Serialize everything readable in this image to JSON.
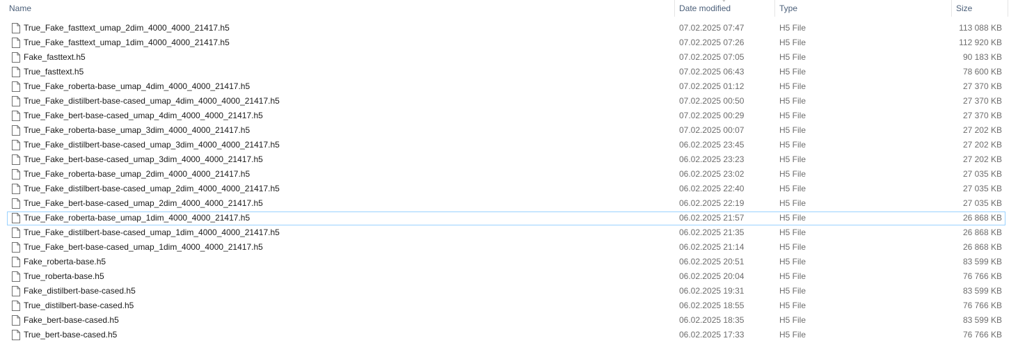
{
  "columns": {
    "name": "Name",
    "date_modified": "Date modified",
    "type": "Type",
    "size": "Size"
  },
  "selected_index": 13,
  "files": [
    {
      "name": "True_Fake_fasttext_umap_2dim_4000_4000_21417.h5",
      "date": "07.02.2025 07:47",
      "type": "H5 File",
      "size": "113 088 KB"
    },
    {
      "name": "True_Fake_fasttext_umap_1dim_4000_4000_21417.h5",
      "date": "07.02.2025 07:26",
      "type": "H5 File",
      "size": "112 920 KB"
    },
    {
      "name": "Fake_fasttext.h5",
      "date": "07.02.2025 07:05",
      "type": "H5 File",
      "size": "90 183 KB"
    },
    {
      "name": "True_fasttext.h5",
      "date": "07.02.2025 06:43",
      "type": "H5 File",
      "size": "78 600 KB"
    },
    {
      "name": "True_Fake_roberta-base_umap_4dim_4000_4000_21417.h5",
      "date": "07.02.2025 01:12",
      "type": "H5 File",
      "size": "27 370 KB"
    },
    {
      "name": "True_Fake_distilbert-base-cased_umap_4dim_4000_4000_21417.h5",
      "date": "07.02.2025 00:50",
      "type": "H5 File",
      "size": "27 370 KB"
    },
    {
      "name": "True_Fake_bert-base-cased_umap_4dim_4000_4000_21417.h5",
      "date": "07.02.2025 00:29",
      "type": "H5 File",
      "size": "27 370 KB"
    },
    {
      "name": "True_Fake_roberta-base_umap_3dim_4000_4000_21417.h5",
      "date": "07.02.2025 00:07",
      "type": "H5 File",
      "size": "27 202 KB"
    },
    {
      "name": "True_Fake_distilbert-base-cased_umap_3dim_4000_4000_21417.h5",
      "date": "06.02.2025 23:45",
      "type": "H5 File",
      "size": "27 202 KB"
    },
    {
      "name": "True_Fake_bert-base-cased_umap_3dim_4000_4000_21417.h5",
      "date": "06.02.2025 23:23",
      "type": "H5 File",
      "size": "27 202 KB"
    },
    {
      "name": "True_Fake_roberta-base_umap_2dim_4000_4000_21417.h5",
      "date": "06.02.2025 23:02",
      "type": "H5 File",
      "size": "27 035 KB"
    },
    {
      "name": "True_Fake_distilbert-base-cased_umap_2dim_4000_4000_21417.h5",
      "date": "06.02.2025 22:40",
      "type": "H5 File",
      "size": "27 035 KB"
    },
    {
      "name": "True_Fake_bert-base-cased_umap_2dim_4000_4000_21417.h5",
      "date": "06.02.2025 22:19",
      "type": "H5 File",
      "size": "27 035 KB"
    },
    {
      "name": "True_Fake_roberta-base_umap_1dim_4000_4000_21417.h5",
      "date": "06.02.2025 21:57",
      "type": "H5 File",
      "size": "26 868 KB"
    },
    {
      "name": "True_Fake_distilbert-base-cased_umap_1dim_4000_4000_21417.h5",
      "date": "06.02.2025 21:35",
      "type": "H5 File",
      "size": "26 868 KB"
    },
    {
      "name": "True_Fake_bert-base-cased_umap_1dim_4000_4000_21417.h5",
      "date": "06.02.2025 21:14",
      "type": "H5 File",
      "size": "26 868 KB"
    },
    {
      "name": "Fake_roberta-base.h5",
      "date": "06.02.2025 20:51",
      "type": "H5 File",
      "size": "83 599 KB"
    },
    {
      "name": "True_roberta-base.h5",
      "date": "06.02.2025 20:04",
      "type": "H5 File",
      "size": "76 766 KB"
    },
    {
      "name": "Fake_distilbert-base-cased.h5",
      "date": "06.02.2025 19:31",
      "type": "H5 File",
      "size": "83 599 KB"
    },
    {
      "name": "True_distilbert-base-cased.h5",
      "date": "06.02.2025 18:55",
      "type": "H5 File",
      "size": "76 766 KB"
    },
    {
      "name": "Fake_bert-base-cased.h5",
      "date": "06.02.2025 18:35",
      "type": "H5 File",
      "size": "83 599 KB"
    },
    {
      "name": "True_bert-base-cased.h5",
      "date": "06.02.2025 17:33",
      "type": "H5 File",
      "size": "76 766 KB"
    }
  ]
}
